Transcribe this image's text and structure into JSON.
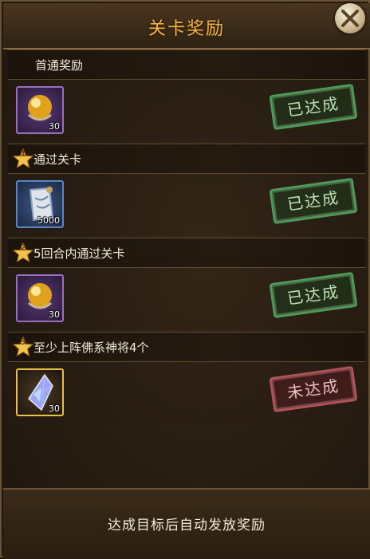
{
  "title": "关卡奖励",
  "sections": [
    {
      "label": "首通奖励",
      "star": ""
    },
    {
      "label": "通过关卡",
      "star": "1"
    },
    {
      "label": "5回合内通过关卡",
      "star": "2"
    },
    {
      "label": "至少上阵佛系神将4个",
      "star": "3"
    }
  ],
  "rewards": [
    {
      "icon": "gold-orb-icon",
      "count": "30",
      "status": "已达成",
      "achieved": true
    },
    {
      "icon": "scroll-icon",
      "count": "5000",
      "status": "已达成",
      "achieved": true
    },
    {
      "icon": "gold-orb-icon",
      "count": "30",
      "status": "已达成",
      "achieved": true
    },
    {
      "icon": "crystal-icon",
      "count": "30",
      "status": "未达成",
      "achieved": false
    }
  ],
  "footer": "达成目标后自动发放奖励",
  "colors": {
    "title": "#f3b53b",
    "achieved": "#4e9a5a",
    "not_achieved": "#b0545a"
  }
}
